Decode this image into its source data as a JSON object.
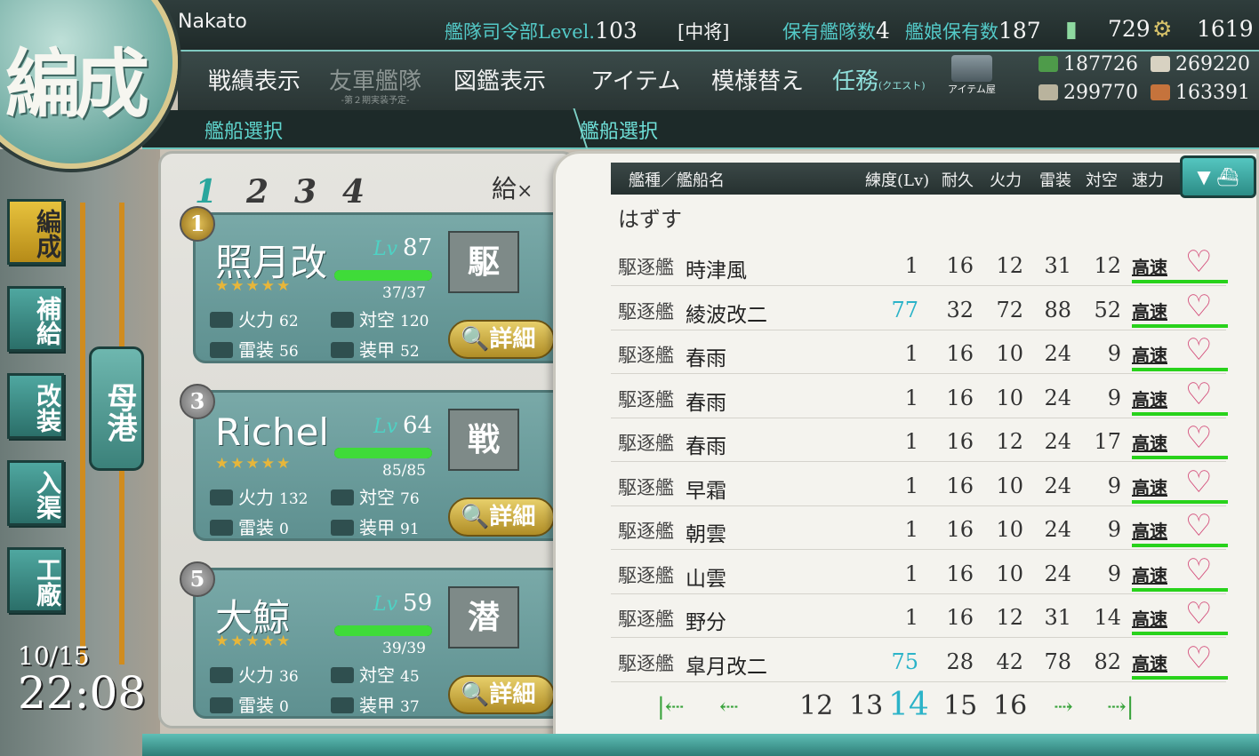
{
  "player": {
    "name": "Nakato"
  },
  "hq": {
    "label": "艦隊司令部Level.",
    "level": "103",
    "rank": "[中将]",
    "fleet_count_label": "保有艦隊数",
    "fleet_count": "4",
    "ship_count_label": "艦娘保有数",
    "ship_count": "187",
    "bucket_count": "729",
    "devmat_count": "1619"
  },
  "menu": {
    "battle_record": "戦績表示",
    "friend_fleet": "友軍艦隊",
    "friend_fleet_sub": "-第２期実装予定-",
    "encyclopedia": "図鑑表示",
    "items": "アイテム",
    "decoration": "模様替え",
    "quest": "任務",
    "quest_sub": "(クエスト)",
    "item_shop": "アイテム屋"
  },
  "resources": {
    "fuel": "187726",
    "ammo": "269220",
    "steel": "299770",
    "bauxite": "163391"
  },
  "breadcrumb": {
    "left": "艦船選択",
    "right": "艦船選択"
  },
  "logo": {
    "text": "編成"
  },
  "nav": {
    "organize": "編成",
    "supply": "補給",
    "remodel": "改装",
    "repair": "入渠",
    "arsenal": "工廠",
    "port": "母港"
  },
  "clock": {
    "date": "10/15",
    "time": "22:08"
  },
  "fleet": {
    "tabs": [
      "1",
      "2",
      "3",
      "4"
    ],
    "supply_tag": "給",
    "close": "×",
    "ships": [
      {
        "slot": "1",
        "name": "照月改",
        "lv_label": "Lv",
        "lv": "87",
        "stars": "★★★★★",
        "hp": "37/37",
        "hp_ratio": 1.0,
        "firepower_label": "火力",
        "firepower": "62",
        "aa_label": "対空",
        "aa": "120",
        "torpedo_label": "雷装",
        "torpedo": "56",
        "armor_label": "装甲",
        "armor": "52",
        "badge": "駆",
        "detail": "詳細"
      },
      {
        "slot": "3",
        "name": "Richel",
        "lv_label": "Lv",
        "lv": "64",
        "stars": "★★★★★",
        "hp": "85/85",
        "hp_ratio": 1.0,
        "firepower_label": "火力",
        "firepower": "132",
        "aa_label": "対空",
        "aa": "76",
        "torpedo_label": "雷装",
        "torpedo": "0",
        "armor_label": "装甲",
        "armor": "91",
        "badge": "戦",
        "detail": "詳細"
      },
      {
        "slot": "5",
        "name": "大鯨",
        "lv_label": "Lv",
        "lv": "59",
        "stars": "★★★★★",
        "hp": "39/39",
        "hp_ratio": 1.0,
        "firepower_label": "火力",
        "firepower": "36",
        "aa_label": "対空",
        "aa": "45",
        "torpedo_label": "雷装",
        "torpedo": "0",
        "armor_label": "装甲",
        "armor": "37",
        "badge": "潜",
        "detail": "詳細"
      }
    ]
  },
  "list": {
    "headers": {
      "type_name": "艦種／艦船名",
      "level": "練度(Lv)",
      "hp": "耐久",
      "fire": "火力",
      "torpedo": "雷装",
      "aa": "対空",
      "speed": "速力"
    },
    "remove": "はずす",
    "rows": [
      {
        "type": "駆逐艦",
        "name": "時津風",
        "lv": "1",
        "hp": "16",
        "fire": "12",
        "torp": "31",
        "aa": "12",
        "speed": "高速"
      },
      {
        "type": "駆逐艦",
        "name": "綾波改二",
        "lv": "77",
        "hp": "32",
        "fire": "72",
        "torp": "88",
        "aa": "52",
        "speed": "高速",
        "hl": true
      },
      {
        "type": "駆逐艦",
        "name": "春雨",
        "lv": "1",
        "hp": "16",
        "fire": "10",
        "torp": "24",
        "aa": "9",
        "speed": "高速"
      },
      {
        "type": "駆逐艦",
        "name": "春雨",
        "lv": "1",
        "hp": "16",
        "fire": "10",
        "torp": "24",
        "aa": "9",
        "speed": "高速"
      },
      {
        "type": "駆逐艦",
        "name": "春雨",
        "lv": "1",
        "hp": "16",
        "fire": "12",
        "torp": "24",
        "aa": "17",
        "speed": "高速"
      },
      {
        "type": "駆逐艦",
        "name": "早霜",
        "lv": "1",
        "hp": "16",
        "fire": "10",
        "torp": "24",
        "aa": "9",
        "speed": "高速"
      },
      {
        "type": "駆逐艦",
        "name": "朝雲",
        "lv": "1",
        "hp": "16",
        "fire": "10",
        "torp": "24",
        "aa": "9",
        "speed": "高速"
      },
      {
        "type": "駆逐艦",
        "name": "山雲",
        "lv": "1",
        "hp": "16",
        "fire": "10",
        "torp": "24",
        "aa": "9",
        "speed": "高速"
      },
      {
        "type": "駆逐艦",
        "name": "野分",
        "lv": "1",
        "hp": "16",
        "fire": "12",
        "torp": "31",
        "aa": "14",
        "speed": "高速"
      },
      {
        "type": "駆逐艦",
        "name": "皐月改二",
        "lv": "75",
        "hp": "28",
        "fire": "42",
        "torp": "78",
        "aa": "82",
        "speed": "高速",
        "hl": true
      }
    ],
    "pages": [
      "12",
      "13",
      "14",
      "15",
      "16"
    ],
    "current_page": "14"
  },
  "colors": {
    "accent": "#2bb3c8",
    "highlight": "#5fd5cd",
    "cond_green": "#28d21b"
  }
}
